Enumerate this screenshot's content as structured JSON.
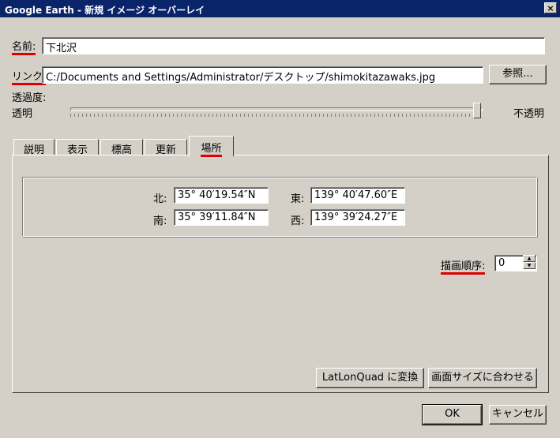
{
  "window": {
    "title": "Google Earth - 新規 イメージ オーバーレイ",
    "close_glyph": "×"
  },
  "form": {
    "name_label": "名前:",
    "name_value": "下北沢",
    "link_label": "リンク:",
    "link_value": "C:/Documents and Settings/Administrator/デスクトップ/shimokitazawaks.jpg",
    "browse_label": "参照...",
    "opacity_label": "透過度:",
    "transparent_label": "透明",
    "opaque_label": "不透明",
    "opacity_value": 1.0
  },
  "tabs": [
    {
      "label": "説明"
    },
    {
      "label": "表示"
    },
    {
      "label": "標高"
    },
    {
      "label": "更新"
    },
    {
      "label": "場所"
    }
  ],
  "active_tab": "場所",
  "location": {
    "north_label": "北:",
    "north_value": "35°  40′19.54″N",
    "south_label": "南:",
    "south_value": "35°  39′11.84″N",
    "east_label": "東:",
    "east_value": "139°  40′47.60″E",
    "west_label": "西:",
    "west_value": "139°  39′24.27″E"
  },
  "draw_order": {
    "label": "描画順序:",
    "value": "0"
  },
  "buttons": {
    "latlonquad": "LatLonQuad に変換",
    "fit_screen": "画面サイズに合わせる",
    "ok": "OK",
    "cancel": "キャンセル"
  },
  "colors": {
    "accent_underline": "#e00000",
    "titlebar": "#0a246a"
  }
}
